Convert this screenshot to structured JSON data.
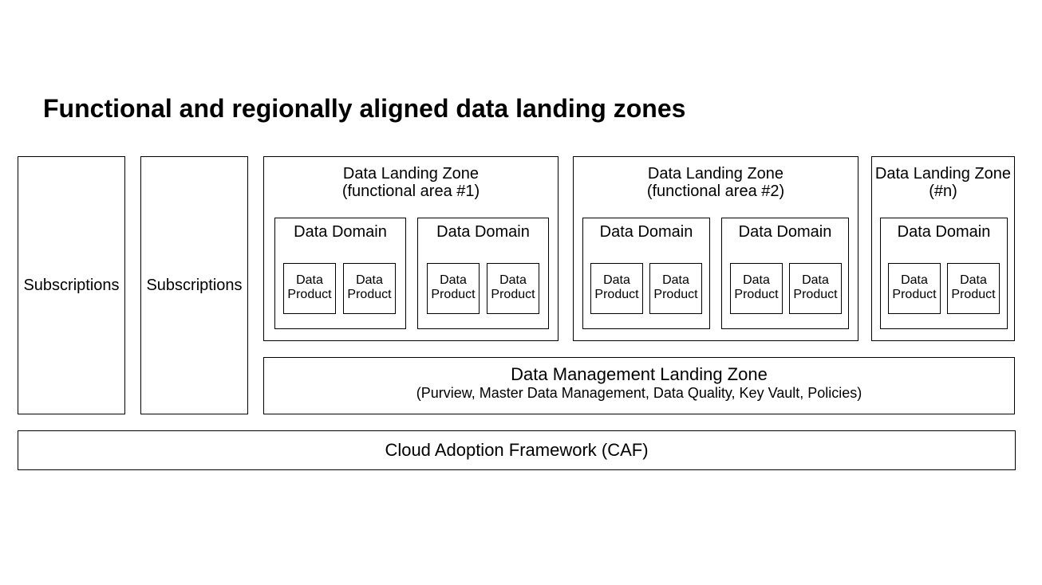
{
  "title": "Functional and regionally aligned data landing zones",
  "subscriptions": {
    "a": "Subscriptions",
    "b": "Subscriptions"
  },
  "zones": {
    "z1": {
      "line1": "Data Landing Zone",
      "line2": "(functional area #1)"
    },
    "z2": {
      "line1": "Data Landing Zone",
      "line2": "(functional area #2)"
    },
    "zn": {
      "line1": "Data Landing Zone",
      "line2": "(#n)"
    }
  },
  "domain_label": "Data Domain",
  "product_label_l1": "Data",
  "product_label_l2": "Product",
  "dmlz": {
    "line1": "Data Management Landing Zone",
    "line2": "(Purview, Master Data Management, Data Quality, Key Vault, Policies)"
  },
  "caf": "Cloud Adoption Framework (CAF)"
}
